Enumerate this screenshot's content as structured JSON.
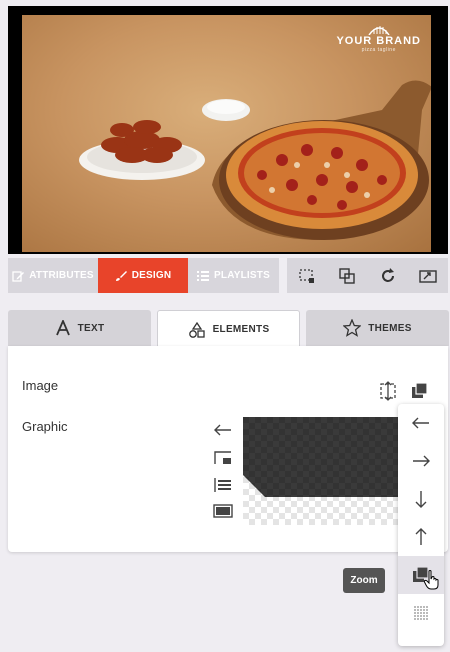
{
  "preview": {
    "brand_name": "YOUR BRAND",
    "brand_tagline": "pizza tagline",
    "icon": "brand-logo"
  },
  "toolbar": {
    "attributes_label": "ATTRIBUTES",
    "design_label": "DESIGN",
    "playlists_label": "PLAYLISTS",
    "accent_color": "#e8442a",
    "tools": [
      "select-region-icon",
      "layers-icon",
      "refresh-icon",
      "resize-icon"
    ]
  },
  "tabs": [
    {
      "label": "TEXT",
      "icon": "text-a-icon"
    },
    {
      "label": "ELEMENTS",
      "icon": "shapes-icon",
      "active": true
    },
    {
      "label": "THEMES",
      "icon": "star-icon"
    }
  ],
  "panel": {
    "rows": [
      {
        "label": "Image"
      },
      {
        "label": "Graphic"
      }
    ]
  },
  "menu": {
    "items": [
      "arrow-left-icon",
      "arrow-right-icon",
      "arrow-down-icon",
      "arrow-up-icon",
      "zoom-icon",
      "dots-grid-icon"
    ],
    "active": "zoom-icon"
  },
  "tooltip": "Zoom"
}
